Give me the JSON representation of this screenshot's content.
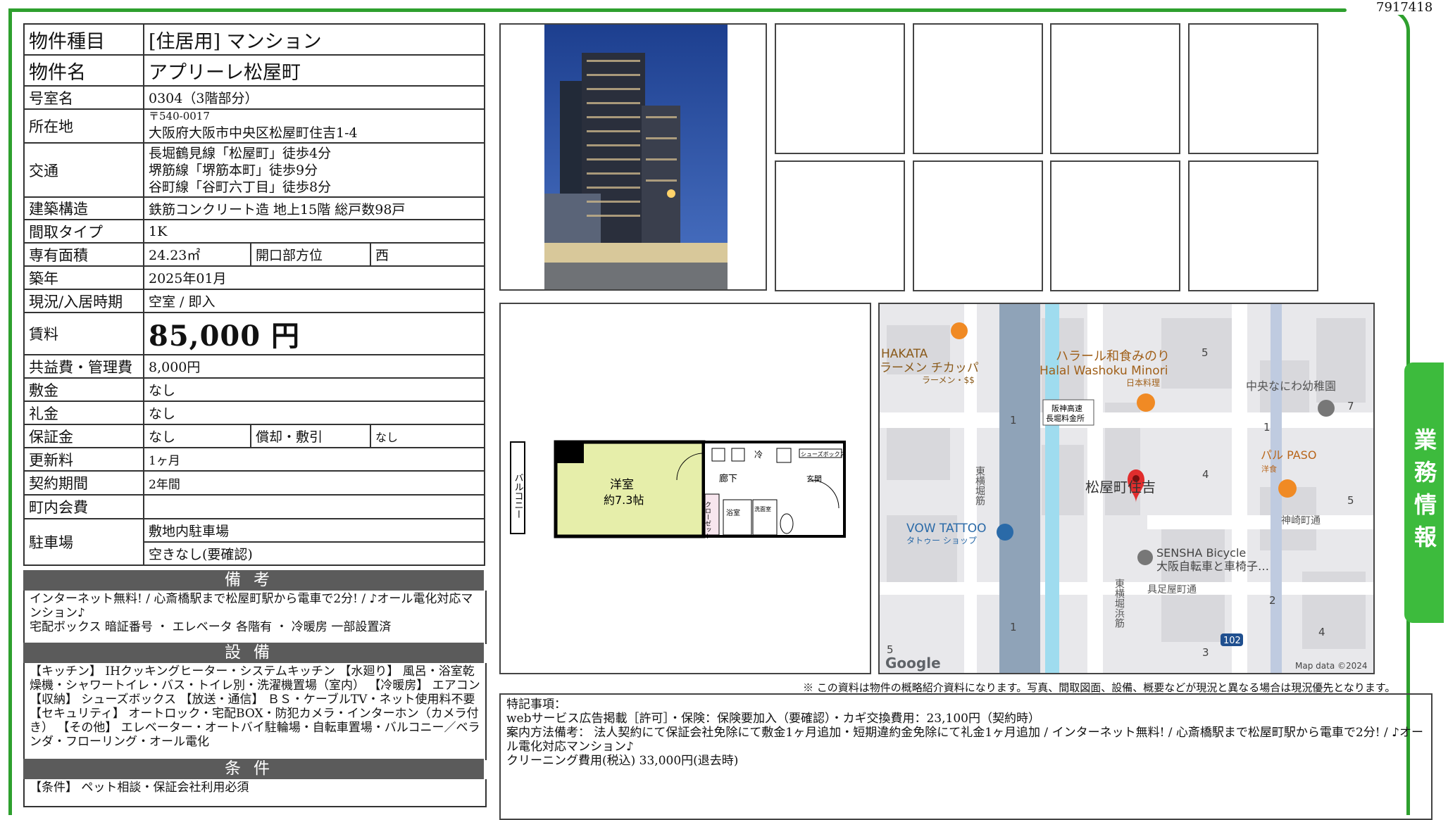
{
  "doc_id": "7917418",
  "side_tab": "業務情報",
  "property": {
    "type_label": "物件種目",
    "type_value": "[住居用] マンション",
    "name_label": "物件名",
    "name_value": "アプリーレ松屋町",
    "room_label": "号室名",
    "room_value": "0304（3階部分）",
    "address_label": "所在地",
    "postal": "〒540-0017",
    "address": "大阪府大阪市中央区松屋町住吉1-4",
    "transit_label": "交通",
    "transit": [
      "長堀鶴見線「松屋町」徒歩4分",
      "堺筋線「堺筋本町」徒歩9分",
      "谷町線「谷町六丁目」徒歩8分"
    ],
    "structure_label": "建築構造",
    "structure_value": "鉄筋コンクリート造 地上15階 総戸数98戸",
    "layout_label": "間取タイプ",
    "layout_value": "1K",
    "area_label": "専有面積",
    "area_value": "24.23㎡",
    "direction_label": "開口部方位",
    "direction_value": "西",
    "built_label": "築年",
    "built_value": "2025年01月",
    "status_label": "現況/入居時期",
    "status_value": "空室 / 即入",
    "rent_label": "賃料",
    "rent_value": "85,000 円",
    "fee_label": "共益費・管理費",
    "fee_value": "8,000円",
    "deposit_label": "敷金",
    "deposit_value": "なし",
    "key_money_label": "礼金",
    "key_money_value": "なし",
    "guarantee_label": "保証金",
    "guarantee_value": "なし",
    "amort_label": "償却・敷引",
    "amort_value": "なし",
    "renewal_label": "更新料",
    "renewal_value": "1ヶ月",
    "contract_label": "契約期間",
    "contract_value": "2年間",
    "community_label": "町内会費",
    "community_value": "",
    "parking_label": "駐車場",
    "parking_value_1": "敷地内駐車場",
    "parking_value_2": "空きなし(要確認)"
  },
  "remarks": {
    "title": "備考",
    "lines": [
      "インターネット無料! / 心斎橋駅まで松屋町駅から電車で2分! / ♪オール電化対応マンション♪",
      "宅配ボックス 暗証番号 ・ エレベータ 各階有 ・ 冷暖房 一部設置済"
    ]
  },
  "equipment": {
    "title": "設備",
    "text": "【キッチン】 IHクッキングヒーター・システムキッチン 【水廻り】 風呂・浴室乾燥機・シャワートイレ・バス・トイレ別・洗濯機置場（室内） 【冷暖房】 エアコン 【収納】 シューズボックス 【放送・通信】 ＢＳ・ケーブルTV・ネット使用料不要 【セキュリティ】 オートロック・宅配BOX・防犯カメラ・インターホン（カメラ付き） 【その他】 エレベーター・オートバイ駐輪場・自転車置場・バルコニー／ベランダ・フローリング・オール電化"
  },
  "conditions": {
    "title": "条件",
    "text": "【条件】 ペット相談・保証会社利用必須"
  },
  "floorplan": {
    "room": "洋室",
    "room_size": "約7.3帖",
    "balcony": "バルコニー",
    "hall": "廊下",
    "entrance": "玄関",
    "closet": "クローゼット",
    "bath": "浴室",
    "washroom": "洗面室",
    "shoebox": "シューズボックス",
    "fridge": "冷"
  },
  "map": {
    "labels": {
      "hakata": "HAKATA",
      "hakata_jp": "ラーメン チカッパ",
      "hakata_sub": "ラーメン・$$",
      "halal_jp": "ハラール和食みのり",
      "halal_en": "Halal Washoku Minori",
      "halal_sub": "日本料理",
      "hanshin": "阪神高速",
      "hanshin2": "長堀料金所",
      "kindergarten": "中央なにわ幼稚園",
      "pal": "パル PASO",
      "pal_sub": "洋食",
      "pin": "松屋町住吉",
      "vow": "VOW TATTOO",
      "vow_sub": "タトゥー ショップ",
      "kanzaki": "神崎町通",
      "sensha": "SENSHA Bicycle",
      "sensha_sub": "大阪自転車と車椅子…",
      "gusoku": "具足屋町通",
      "road1": "東横堀筋",
      "road2": "東横堀浜筋",
      "route": "102",
      "google": "Google",
      "mapdata": "Map data ©2024",
      "n1": "1",
      "n1b": "1",
      "n1c": "1",
      "n2": "2",
      "n3": "3",
      "n4": "4",
      "n4b": "4",
      "n5": "5",
      "n5b": "5",
      "n5c": "5",
      "n7": "7"
    }
  },
  "disclaimer": "※ この資料は物件の概略紹介資料になります。写真、間取図面、設備、概要などが現況と異なる場合は現況優先となります。",
  "special_notes": {
    "title": "特記事項：",
    "lines": [
      "webサービス広告掲載［許可］・保険：保険要加入（要確認）・カギ交換費用：23,100円（契約時）",
      "案内方法備考： 法人契約にて保証会社免除にて敷金1ヶ月追加・短期違約金免除にて礼金1ヶ月追加 / インターネット無料! / 心斎橋駅まで松屋町駅から電車で2分! / ♪オール電化対応マンション♪",
      "クリーニング費用(税込) 33,000円(退去時)"
    ]
  }
}
